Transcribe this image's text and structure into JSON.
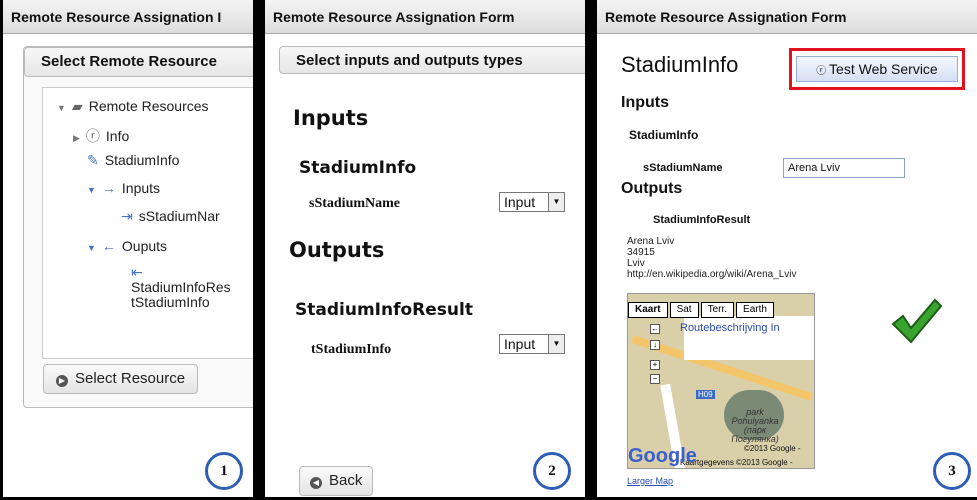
{
  "panel1": {
    "title": "Remote Resource Assignation I",
    "section": "Select Remote Resource",
    "tree": {
      "root": "Remote Resources",
      "info": "Info",
      "resource": "StadiumInfo",
      "inputs": "Inputs",
      "input_param": "sStadiumNar",
      "outputs": "Ouputs",
      "output_param_1": "StadiumInfoRes",
      "output_param_2": "tStadiumInfo"
    },
    "button": "Select Resource",
    "step": "1"
  },
  "panel2": {
    "title": "Remote Resource Assignation Form",
    "section": "Select inputs and outputs types",
    "inputs_heading": "Inputs",
    "input_group": "StadiumInfo",
    "input_label": "sStadiumName",
    "input_select": "Input",
    "outputs_heading": "Outputs",
    "output_group": "StadiumInfoResult",
    "output_label": "tStadiumInfo",
    "output_select": "Input",
    "back_button": "Back",
    "step": "2"
  },
  "panel3": {
    "title": "Remote Resource Assignation Form",
    "resource_title": "StadiumInfo",
    "test_button": "Test Web Service",
    "inputs_heading": "Inputs",
    "input_group": "StadiumInfo",
    "input_label": "sStadiumName",
    "input_value": "Arena Lviv",
    "outputs_heading": "Outputs",
    "output_group": "StadiumInfoResult",
    "result_lines": [
      "Arena Lviv",
      "34915",
      "Lviv",
      "http://en.wikipedia.org/wiki/Arena_Lviv"
    ],
    "map": {
      "tabs": [
        "Kaart",
        "Sat",
        "Terr.",
        "Earth"
      ],
      "link": "Routebeschrijving  In",
      "park_label": "park Pohulyanka (парк Погулянка)",
      "road_label": "H09",
      "copyright_1": "©2013 Google -",
      "copyright_2": "Kaartgegevens ©2013 Google -",
      "logo": "Google",
      "larger_map": "Larger Map"
    },
    "step": "3"
  }
}
